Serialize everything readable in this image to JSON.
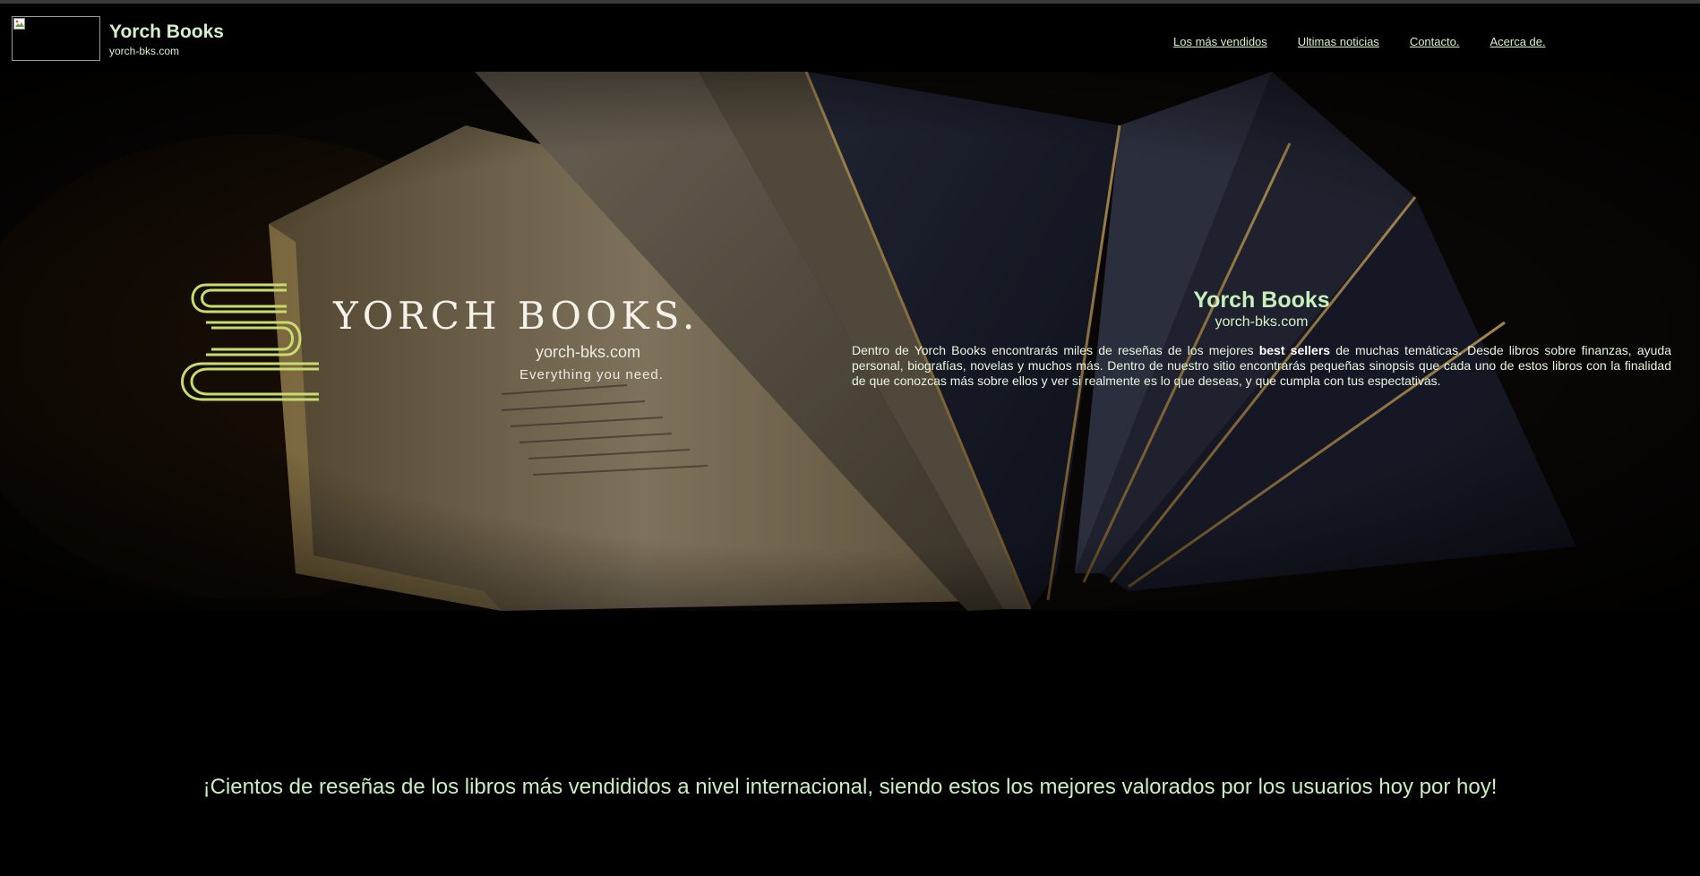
{
  "header": {
    "title": "Yorch Books",
    "url": "yorch-bks.com",
    "nav": [
      {
        "label": "Los más vendidos"
      },
      {
        "label": "Ultimas noticias"
      },
      {
        "label": "Contacto."
      },
      {
        "label": "Acerca de."
      }
    ]
  },
  "hero": {
    "logo_text": "YORCH BOOKS.",
    "logo_url": "yorch-bks.com",
    "logo_tagline": "Everything you need.",
    "title": "Yorch Books",
    "subtitle": "yorch-bks.com",
    "desc_before": "Dentro de Yorch Books encontrarás miles de reseñas de los mejores ",
    "desc_bold": "best sellers",
    "desc_after": " de muchas temáticas. Desde libros sobre finanzas, ayuda personal, biografías, novelas y muchos más. Dentro de nuestro sitio encontrarás pequeñas sinopsis que cada uno de estos libros con la finalidad de que conozcas más sobre ellos y ver si realmente es lo que deseas, y que cumpla con tus espectativas."
  },
  "tagline": "¡Cientos de reseñas de los libros más vendididos a nivel internacional, siendo estos los mejores valorados por los usuarios hoy por hoy!",
  "colors": {
    "accent": "#c8f0bd",
    "background": "#000000",
    "logo_icon": "#c8dc6e"
  }
}
